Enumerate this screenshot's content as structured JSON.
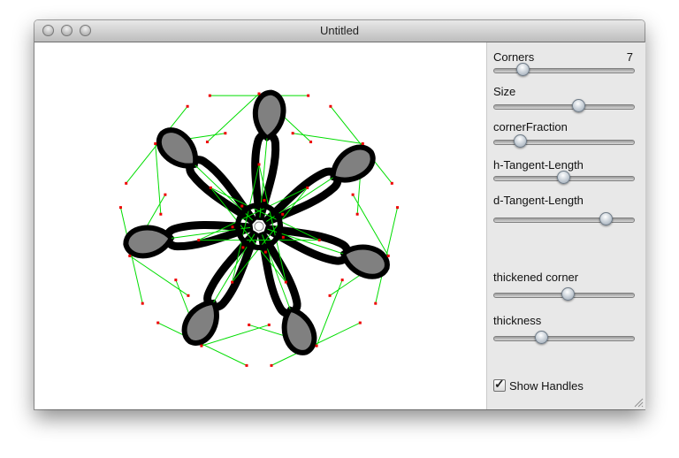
{
  "window": {
    "title": "Untitled"
  },
  "controls": {
    "corners": {
      "label": "Corners",
      "value": "7",
      "level": 0.18
    },
    "size": {
      "label": "Size",
      "level": 0.62
    },
    "corner_fraction": {
      "label": "cornerFraction",
      "level": 0.16
    },
    "h_tangent_length": {
      "label": "h-Tangent-Length",
      "level": 0.5
    },
    "d_tangent_length": {
      "label": "d-Tangent-Length",
      "level": 0.84
    },
    "thickened_corner": {
      "label": "thickened corner",
      "level": 0.54
    },
    "thickness": {
      "label": "thickness",
      "level": 0.33
    },
    "show_handles": {
      "label": "Show Handles",
      "checked": true
    }
  },
  "colors": {
    "handle_line": "#00dd00",
    "handle_point": "#ee0000",
    "shape_fill": "#808080",
    "shape_stroke": "#000000"
  }
}
